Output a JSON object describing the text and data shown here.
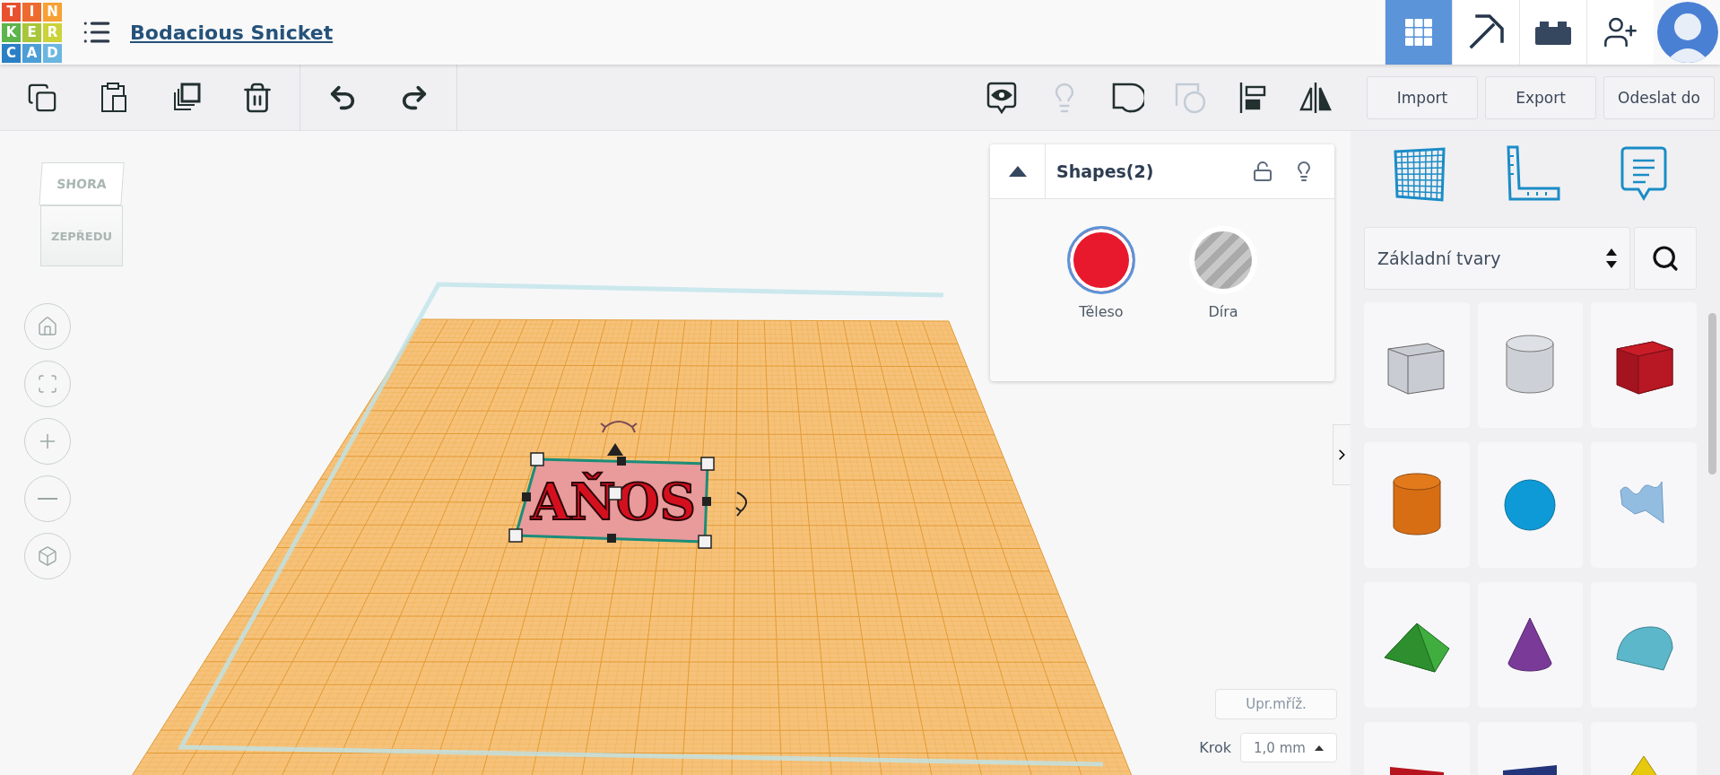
{
  "logo": {
    "letters": [
      {
        "text": "T",
        "color": "#e8502f"
      },
      {
        "text": "I",
        "color": "#ee6b2f"
      },
      {
        "text": "N",
        "color": "#f7a034"
      },
      {
        "text": "K",
        "color": "#5db44a"
      },
      {
        "text": "E",
        "color": "#a8c63a"
      },
      {
        "text": "R",
        "color": "#cbd33a"
      },
      {
        "text": "C",
        "color": "#2a7fc6"
      },
      {
        "text": "A",
        "color": "#4c9ed6"
      },
      {
        "text": "D",
        "color": "#6ab6e0"
      }
    ]
  },
  "header": {
    "title": "Bodacious Snicket",
    "views": [
      {
        "kind": "grid",
        "selected": true
      },
      {
        "kind": "pickaxe",
        "selected": false
      },
      {
        "kind": "bricks",
        "selected": false
      }
    ]
  },
  "toolbar": {
    "edit_tools": [
      {
        "kind": "copy"
      },
      {
        "kind": "paste"
      },
      {
        "kind": "duplicate"
      },
      {
        "kind": "delete"
      },
      {
        "kind": "undo"
      },
      {
        "kind": "redo"
      }
    ],
    "shape_tools": [
      {
        "kind": "notes",
        "disabled": false
      },
      {
        "kind": "bulb",
        "disabled": true
      },
      {
        "kind": "group",
        "disabled": false
      },
      {
        "kind": "hole-group",
        "disabled": true
      },
      {
        "kind": "align",
        "disabled": false
      },
      {
        "kind": "mirror",
        "disabled": false
      }
    ],
    "buttons": [
      "Import",
      "Export",
      "Odeslat do"
    ]
  },
  "view_cube": {
    "top": "SHORA",
    "front": "ZEPŘEDU"
  },
  "inspector": {
    "title": "Shapes(2)",
    "options": [
      {
        "kind": "solid",
        "label": "Těleso",
        "selected": true
      },
      {
        "kind": "hole",
        "label": "Díra",
        "selected": false
      }
    ]
  },
  "scene": {
    "object_text": "AŇOS"
  },
  "grid_controls": {
    "edit_grid": "Upr.mříž.",
    "step_label": "Krok",
    "step_value": "1,0 mm"
  },
  "library": {
    "category": "Základní tvary",
    "shapes": [
      {
        "kind": "box-hole"
      },
      {
        "kind": "cylinder-hole"
      },
      {
        "kind": "box"
      },
      {
        "kind": "cylinder"
      },
      {
        "kind": "sphere"
      },
      {
        "kind": "scribble"
      },
      {
        "kind": "roof"
      },
      {
        "kind": "cone"
      },
      {
        "kind": "round-roof"
      },
      {
        "kind": "text"
      },
      {
        "kind": "wedge"
      },
      {
        "kind": "pyramid"
      }
    ]
  }
}
